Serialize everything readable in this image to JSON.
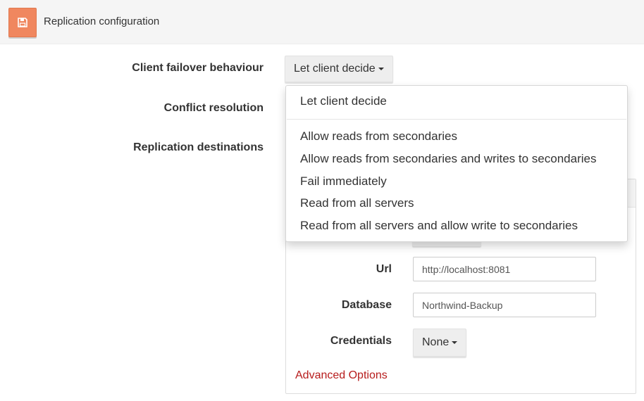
{
  "header": {
    "title": "Replication configuration",
    "save_icon": "floppy-disk-icon",
    "accent": "#f0875f"
  },
  "form": {
    "client_failover": {
      "label": "Client failover behaviour",
      "value": "Let client decide"
    },
    "conflict_resolution": {
      "label": "Conflict resolution"
    },
    "replication_destinations": {
      "label": "Replication destinations"
    }
  },
  "failover_menu": {
    "items": [
      "Let client decide",
      "Allow reads from secondaries",
      "Allow reads from secondaries and writes to secondaries",
      "Fail immediately",
      "Read from all servers",
      "Read from all servers and allow write to secondaries"
    ]
  },
  "destination": {
    "url": {
      "label": "Url",
      "value": "http://localhost:8081"
    },
    "database": {
      "label": "Database",
      "value": "Northwind-Backup"
    },
    "credentials": {
      "label": "Credentials",
      "value": "None"
    },
    "advanced_link": "Advanced Options",
    "link_color": "#b71c1c"
  }
}
